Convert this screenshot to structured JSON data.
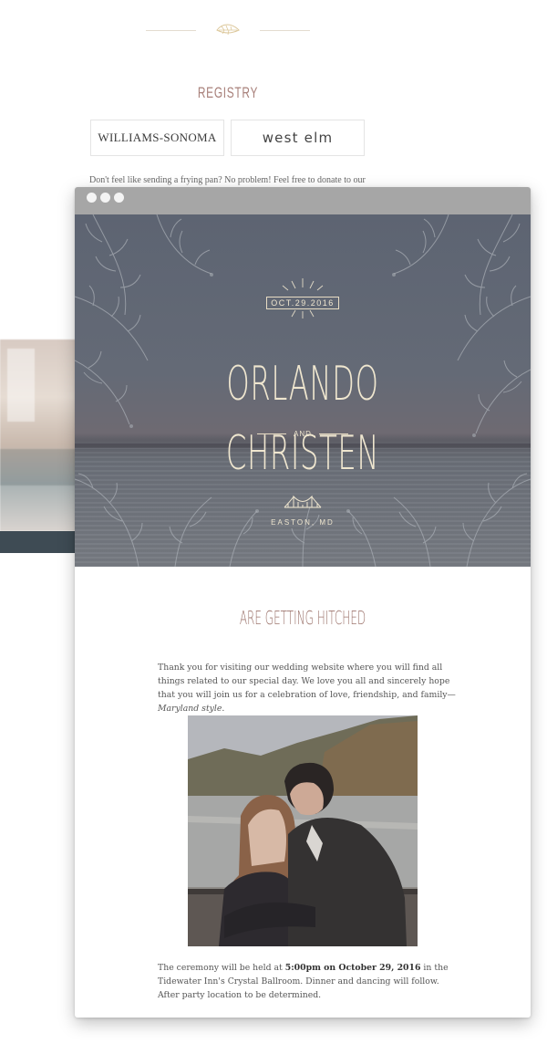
{
  "registry": {
    "title": "REGISTRY",
    "stores": [
      "WILLIAMS-SONOMA",
      "west elm"
    ],
    "text": "Don't feel like sending a frying pan? No problem! Feel free to donate to our"
  },
  "browser": {
    "hero": {
      "date": "OCT.29.2016",
      "name1": "ORLANDO",
      "and": "AND",
      "name2": "CHRISTEN",
      "location": "EASTON, MD"
    },
    "subtitle": "ARE GETTING HITCHED",
    "intro": {
      "text": "Thank you for visiting our wedding website where you will find all things related to our special day. We love you all and sincerely hope that you will join us for a celebration of love, friendship, and family—",
      "italic": "Maryland style",
      "end": "."
    },
    "ceremony": {
      "pre": "The ceremony will be held at ",
      "bold": "5:00pm on October 29, 2016",
      "post": " in the Tidewater Inn's Crystal Ballroom. Dinner and dancing will follow. After party location to be determined."
    }
  },
  "colors": {
    "accent": "#9c746c",
    "hero_overlay": "#5d6472",
    "hero_text": "#efe6cf",
    "titlebar": "#a6a6a6",
    "side_bar": "#3e4b54"
  },
  "icons": [
    "feather-ornament-icon",
    "window-dot-icon",
    "bridge-icon",
    "foliage-ornament"
  ]
}
